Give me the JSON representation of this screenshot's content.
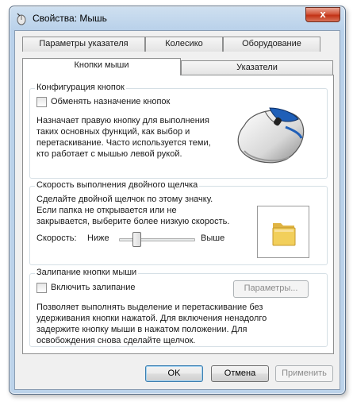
{
  "window": {
    "title": "Свойства: Мышь",
    "close_glyph": "x"
  },
  "tabs": {
    "row_back": [
      "Параметры указателя",
      "Колесико",
      "Оборудование"
    ],
    "row_front": [
      "Кнопки мыши",
      "Указатели"
    ],
    "active": "Кнопки мыши"
  },
  "button_config": {
    "group_title": "Конфигурация кнопок",
    "checkbox_label": "Обменять назначение кнопок",
    "checked": false,
    "description": [
      "Назначает правую кнопку для выполнения",
      "таких основных функций, как выбор и",
      "перетаскивание. Часто используется теми,",
      "кто работает с мышью левой рукой."
    ]
  },
  "double_click": {
    "group_title": "Скорость выполнения двойного щелчка",
    "description": [
      "Сделайте двойной щелчок по этому значку.",
      "Если папка не открывается или не",
      "закрывается, выберите более низкую скорость."
    ],
    "speed_label": "Скорость:",
    "low_label": "Ниже",
    "high_label": "Выше",
    "slider_value": 0.27
  },
  "click_lock": {
    "group_title": "Залипание кнопки мыши",
    "checkbox_label": "Включить залипание",
    "checked": false,
    "settings_button": "Параметры...",
    "description": [
      "Позволяет выполнять выделение и перетаскивание без",
      "удерживания кнопки нажатой. Для включения ненадолго",
      "задержите кнопку мыши в нажатом положении. Для",
      "освобождения снова сделайте щелчок."
    ]
  },
  "footer": {
    "ok": "OK",
    "cancel": "Отмена",
    "apply": "Применить"
  },
  "colors": {
    "annotation_red": "#d42a25",
    "folder_yellow": "#f2cf5b",
    "mouse_blue": "#1f5fb8"
  }
}
